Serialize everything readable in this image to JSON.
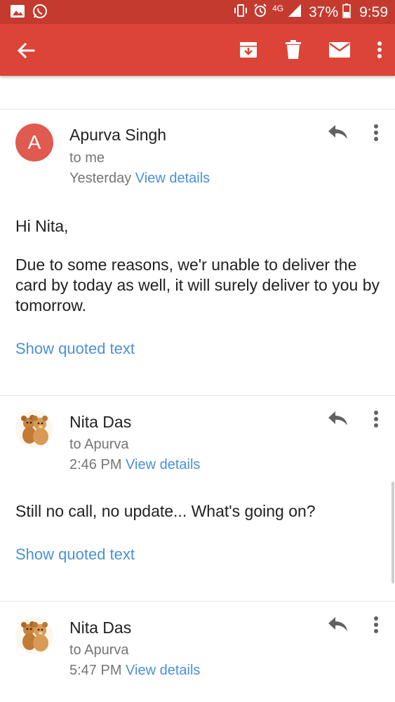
{
  "status_bar": {
    "network": "4G",
    "battery": "37%",
    "time": "9:59"
  },
  "messages": [
    {
      "sender": "Apurva Singh",
      "avatar_letter": "A",
      "recipient": "to me",
      "time": "Yesterday",
      "view_details": "View details",
      "body_greeting": "Hi Nita,",
      "body_text": "Due to some reasons, we'r unable to deliver the card by today as well, it will surely deliver to you by tomorrow.",
      "show_quoted": "Show quoted text"
    },
    {
      "sender": "Nita Das",
      "recipient": "to Apurva",
      "time": "2:46 PM",
      "view_details": "View details",
      "body_text": "Still no call, no update... What's going on?",
      "show_quoted": "Show quoted text"
    },
    {
      "sender": "Nita Das",
      "recipient": "to Apurva",
      "time": "5:47 PM",
      "view_details": "View details"
    }
  ],
  "colors": {
    "status_bar": "#c53a2f",
    "app_bar": "#db4437",
    "link": "#4a90d9",
    "avatar": "#e05a4f"
  }
}
